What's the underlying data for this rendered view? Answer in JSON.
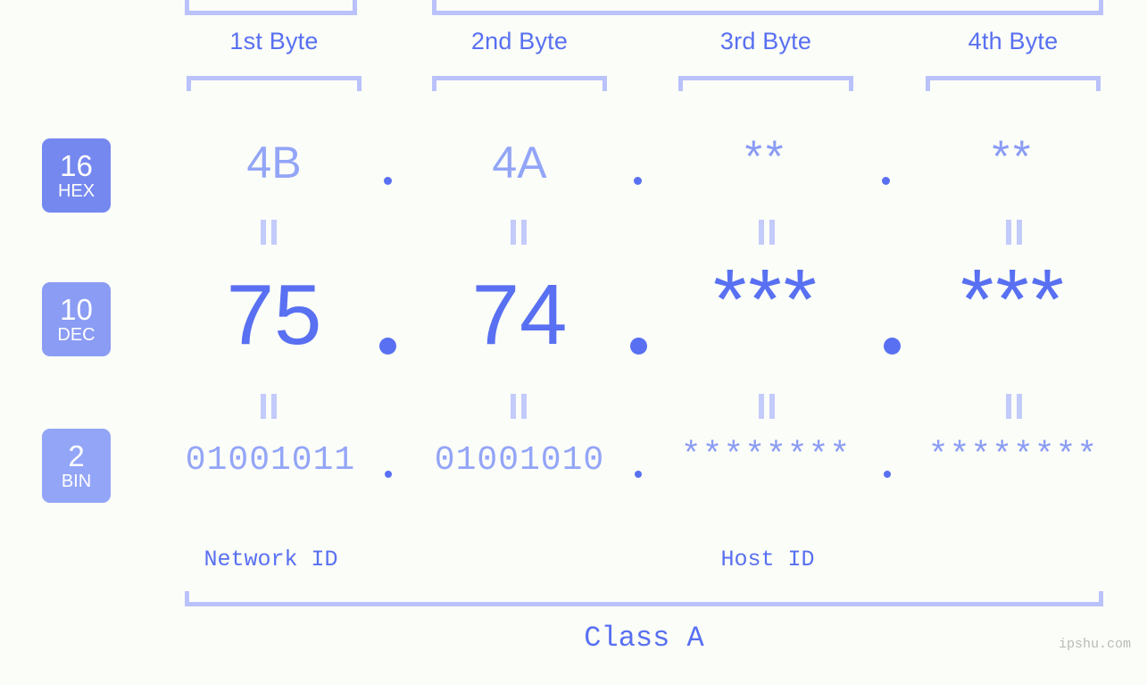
{
  "background_color": "#fbfdf8",
  "accent_color": "#5870f1",
  "muted_accent_color": "#93a5f7",
  "bracket_color": "#b9c2fb",
  "headers": [
    {
      "label": "1st Byte"
    },
    {
      "label": "2nd Byte"
    },
    {
      "label": "3rd Byte"
    },
    {
      "label": "4th Byte"
    }
  ],
  "rows": {
    "hex": {
      "badge_number": "16",
      "badge_name": "HEX",
      "badge_color": "#7588ef",
      "values": [
        "4B",
        "4A",
        "**",
        "**"
      ]
    },
    "dec": {
      "badge_number": "10",
      "badge_name": "DEC",
      "badge_color": "#8b9cf4",
      "values": [
        "75",
        "74",
        "***",
        "***"
      ]
    },
    "bin": {
      "badge_number": "2",
      "badge_name": "BIN",
      "badge_color": "#93a5f7",
      "values": [
        "01001011",
        "01001010",
        "********",
        "********"
      ]
    }
  },
  "separators": {
    "hex": [
      ".",
      ".",
      "."
    ],
    "dec": [
      ".",
      ".",
      "."
    ],
    "bin": [
      ".",
      ".",
      "."
    ]
  },
  "equals_connectors": [
    "=",
    "=",
    "=",
    "=",
    "=",
    "=",
    "=",
    "="
  ],
  "segments": [
    {
      "label": "Network ID"
    },
    {
      "label": "Host ID"
    }
  ],
  "class": {
    "label": "Class A"
  },
  "watermark": {
    "text": "ipshu.com"
  }
}
